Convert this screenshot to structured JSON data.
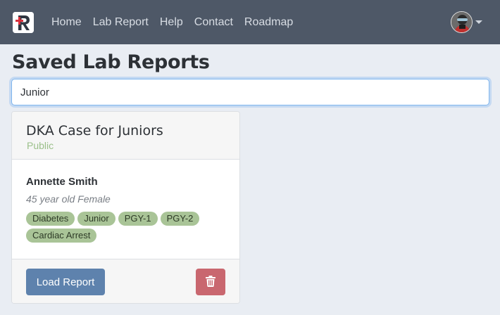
{
  "navbar": {
    "brand_icon": "logo-r-icon",
    "links": [
      {
        "label": "Home"
      },
      {
        "label": "Lab Report"
      },
      {
        "label": "Help"
      },
      {
        "label": "Contact"
      },
      {
        "label": "Roadmap"
      }
    ],
    "user_icon": "avatar"
  },
  "page": {
    "title": "Saved Lab Reports"
  },
  "search": {
    "value": "Junior",
    "placeholder": ""
  },
  "reports": [
    {
      "title": "DKA Case for Juniors",
      "visibility": "Public",
      "patient_name": "Annette Smith",
      "patient_desc": "45 year old Female",
      "tags": [
        "Diabetes",
        "Junior",
        "PGY-1",
        "PGY-2",
        "Cardiac Arrest"
      ],
      "load_label": "Load Report",
      "delete_icon": "trash-icon"
    }
  ],
  "colors": {
    "navbar": "#4e5867",
    "tag": "#a9c497",
    "primary": "#5e82ad",
    "danger": "#c9676f",
    "visibility": "#9bc08a"
  }
}
